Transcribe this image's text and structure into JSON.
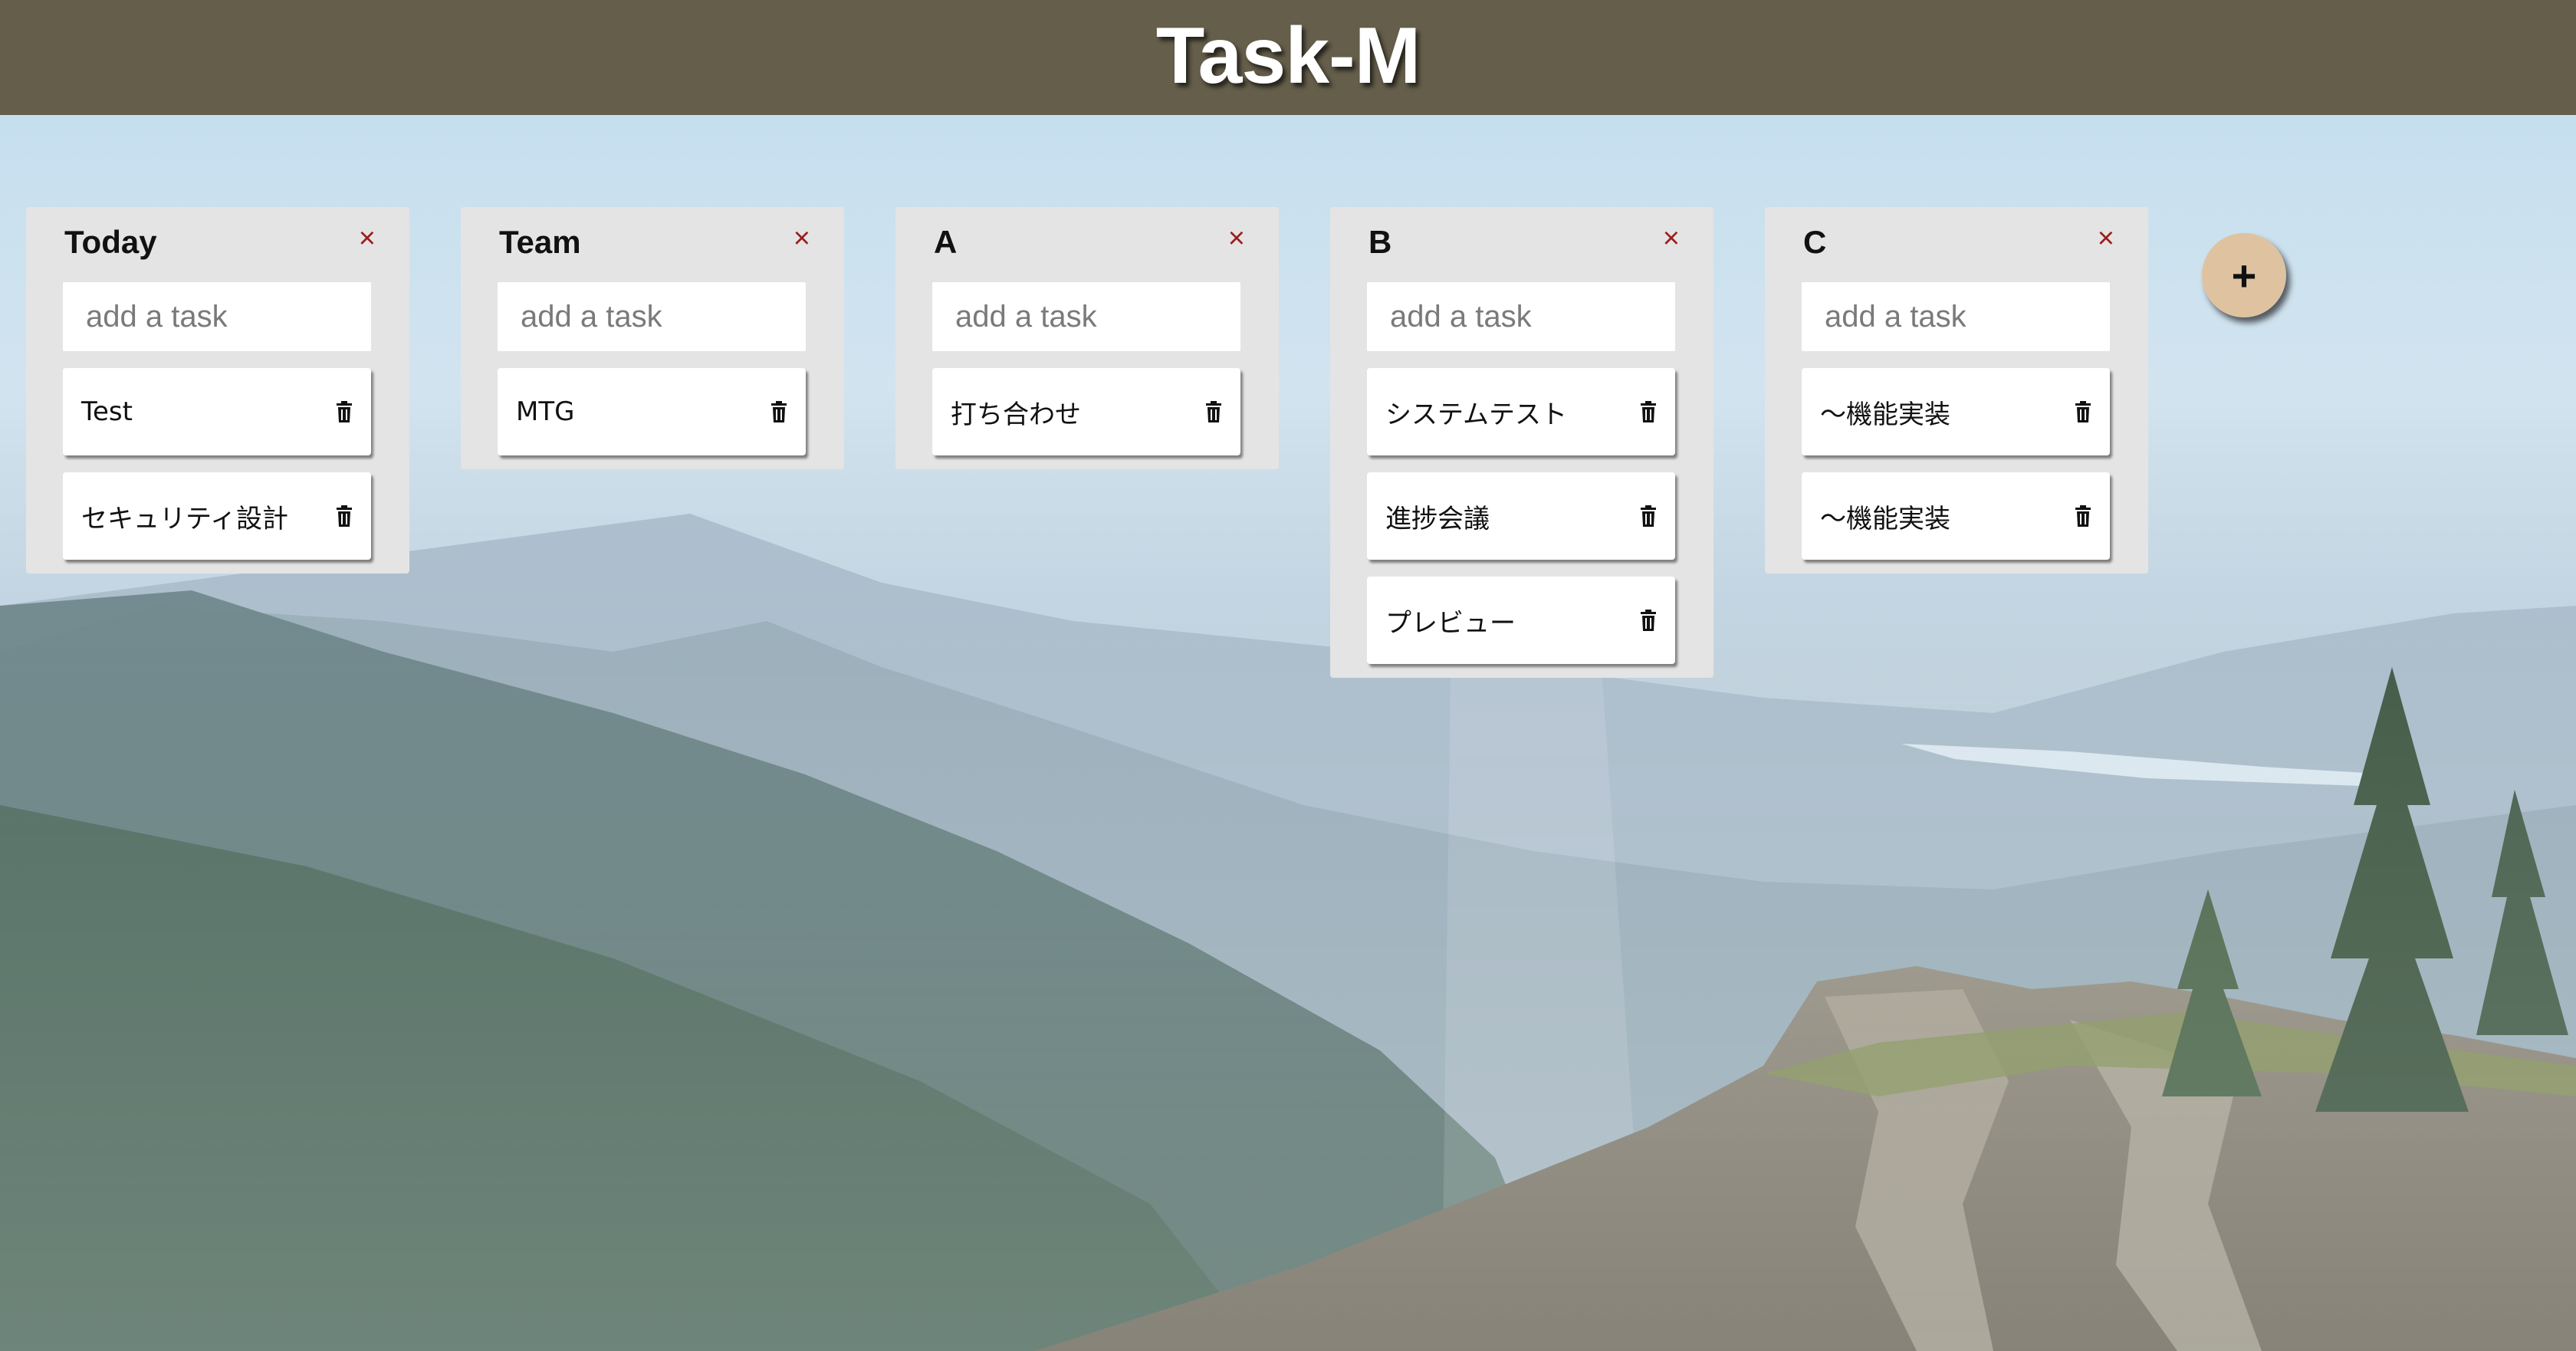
{
  "app": {
    "title": "Task-M"
  },
  "boards": [
    {
      "title": "Today",
      "close_icon": "×",
      "input_placeholder": "add a task",
      "tasks": [
        "Test",
        "セキュリティ設計"
      ]
    },
    {
      "title": "Team",
      "close_icon": "×",
      "input_placeholder": "add a task",
      "tasks": [
        "MTG"
      ]
    },
    {
      "title": "A",
      "close_icon": "×",
      "input_placeholder": "add a task",
      "tasks": [
        "打ち合わせ"
      ]
    },
    {
      "title": "B",
      "close_icon": "×",
      "input_placeholder": "add a task",
      "tasks": [
        "システムテスト",
        "進捗会議",
        "プレビュー"
      ]
    },
    {
      "title": "C",
      "close_icon": "×",
      "input_placeholder": "add a task",
      "tasks": [
        "〜機能実装",
        "〜機能実装"
      ]
    }
  ],
  "add_board_button": {
    "label": "+"
  },
  "colors": {
    "header_bg": "#655e4b",
    "board_bg": "#e4e4e4",
    "close_icon": "#9c1c1c",
    "add_board_bg": "#dfc3a1"
  },
  "icons": {
    "board_close": "close-icon",
    "task_delete": "trash-icon",
    "add_board": "plus-icon"
  }
}
